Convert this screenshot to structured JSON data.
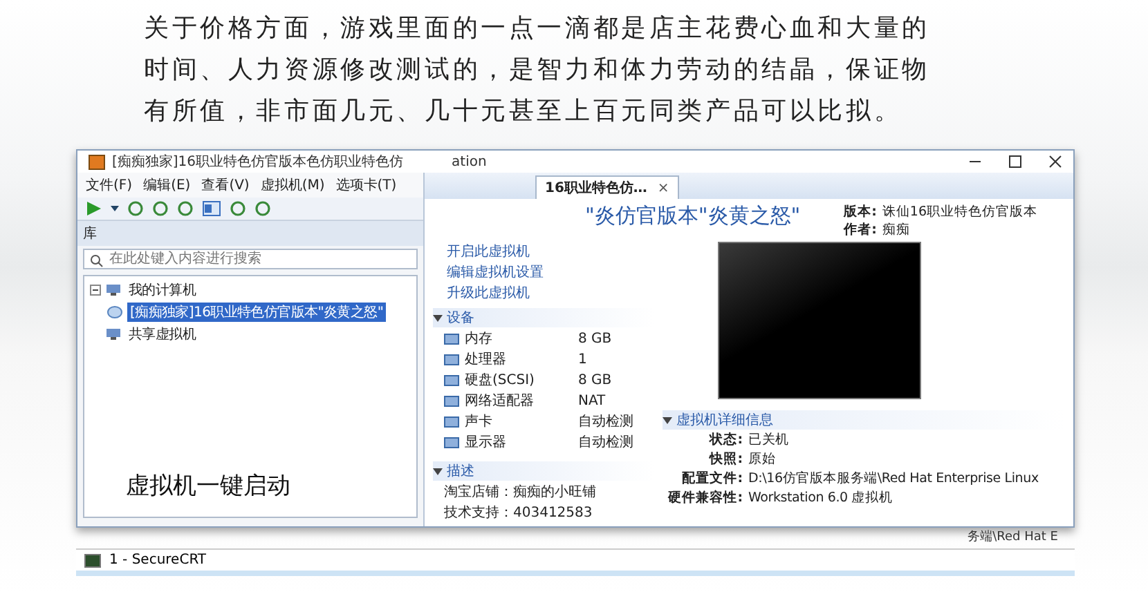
{
  "intro_text": "关于价格方面，游戏里面的一点一滴都是店主花费心血和大量的时间、人力资源修改测试的，是智力和体力劳动的结晶，保证物有所值，非市面几元、几十元甚至上百元同类产品可以比拟。",
  "window": {
    "title": "[痴痴独家]16职业特色仿官版本色仿职业特色仿",
    "title_tail": "ation"
  },
  "menu": [
    "文件(F)",
    "编辑(E)",
    "查看(V)",
    "虚拟机(M)",
    "选项卡(T)"
  ],
  "library": {
    "heading": "库",
    "search": {
      "placeholder": "在此处键入内容进行搜索"
    },
    "tree": [
      {
        "label": "我的计算机",
        "expanded": true,
        "children": [
          {
            "label": "[痴痴独家]16职业特色仿官版本\"炎黄之怒\"",
            "selected": true
          }
        ]
      },
      {
        "label": "共享虚拟机",
        "selected": false
      }
    ]
  },
  "caption": "虚拟机一键启动",
  "tab": {
    "label": "16职业特色仿…",
    "close": "×"
  },
  "vm": {
    "title": "\"炎仿官版本\"炎黄之怒\"",
    "meta": [
      {
        "label": "版本:",
        "value": "诛仙16职业特色仿官版本"
      },
      {
        "label": "作者:",
        "value": "痴痴"
      }
    ]
  },
  "actions": [
    "开启此虚拟机",
    "编辑虚拟机设置",
    "升级此虚拟机"
  ],
  "devices": {
    "heading": "设备",
    "expanded": true,
    "rows": [
      {
        "name": "内存",
        "value": "8 GB"
      },
      {
        "name": "处理器",
        "value": "1"
      },
      {
        "name": "硬盘(SCSI)",
        "value": "8 GB"
      },
      {
        "name": "网络适配器",
        "value": "NAT"
      },
      {
        "name": "声卡",
        "value": "自动检测"
      },
      {
        "name": "显示器",
        "value": "自动检测"
      }
    ]
  },
  "description": {
    "heading": "描述",
    "expanded": true,
    "lines": [
      "淘宝店铺：痴痴的小旺铺",
      "技术支持：403412583"
    ]
  },
  "details": {
    "heading": "虚拟机详细信息",
    "expanded": true,
    "rows": [
      {
        "label": "状态:",
        "value": "已关机"
      },
      {
        "label": "快照:",
        "value": "原始"
      },
      {
        "label": "配置文件:",
        "value": "D:\\16仿官版本服务端\\Red Hat Enterprise Linux"
      },
      {
        "label": "硬件兼容性:",
        "value": "Workstation 6.0 虚拟机"
      }
    ]
  },
  "behind_text": "务端\\Red Hat E",
  "second_window": {
    "title": "1 - SecureCRT"
  }
}
